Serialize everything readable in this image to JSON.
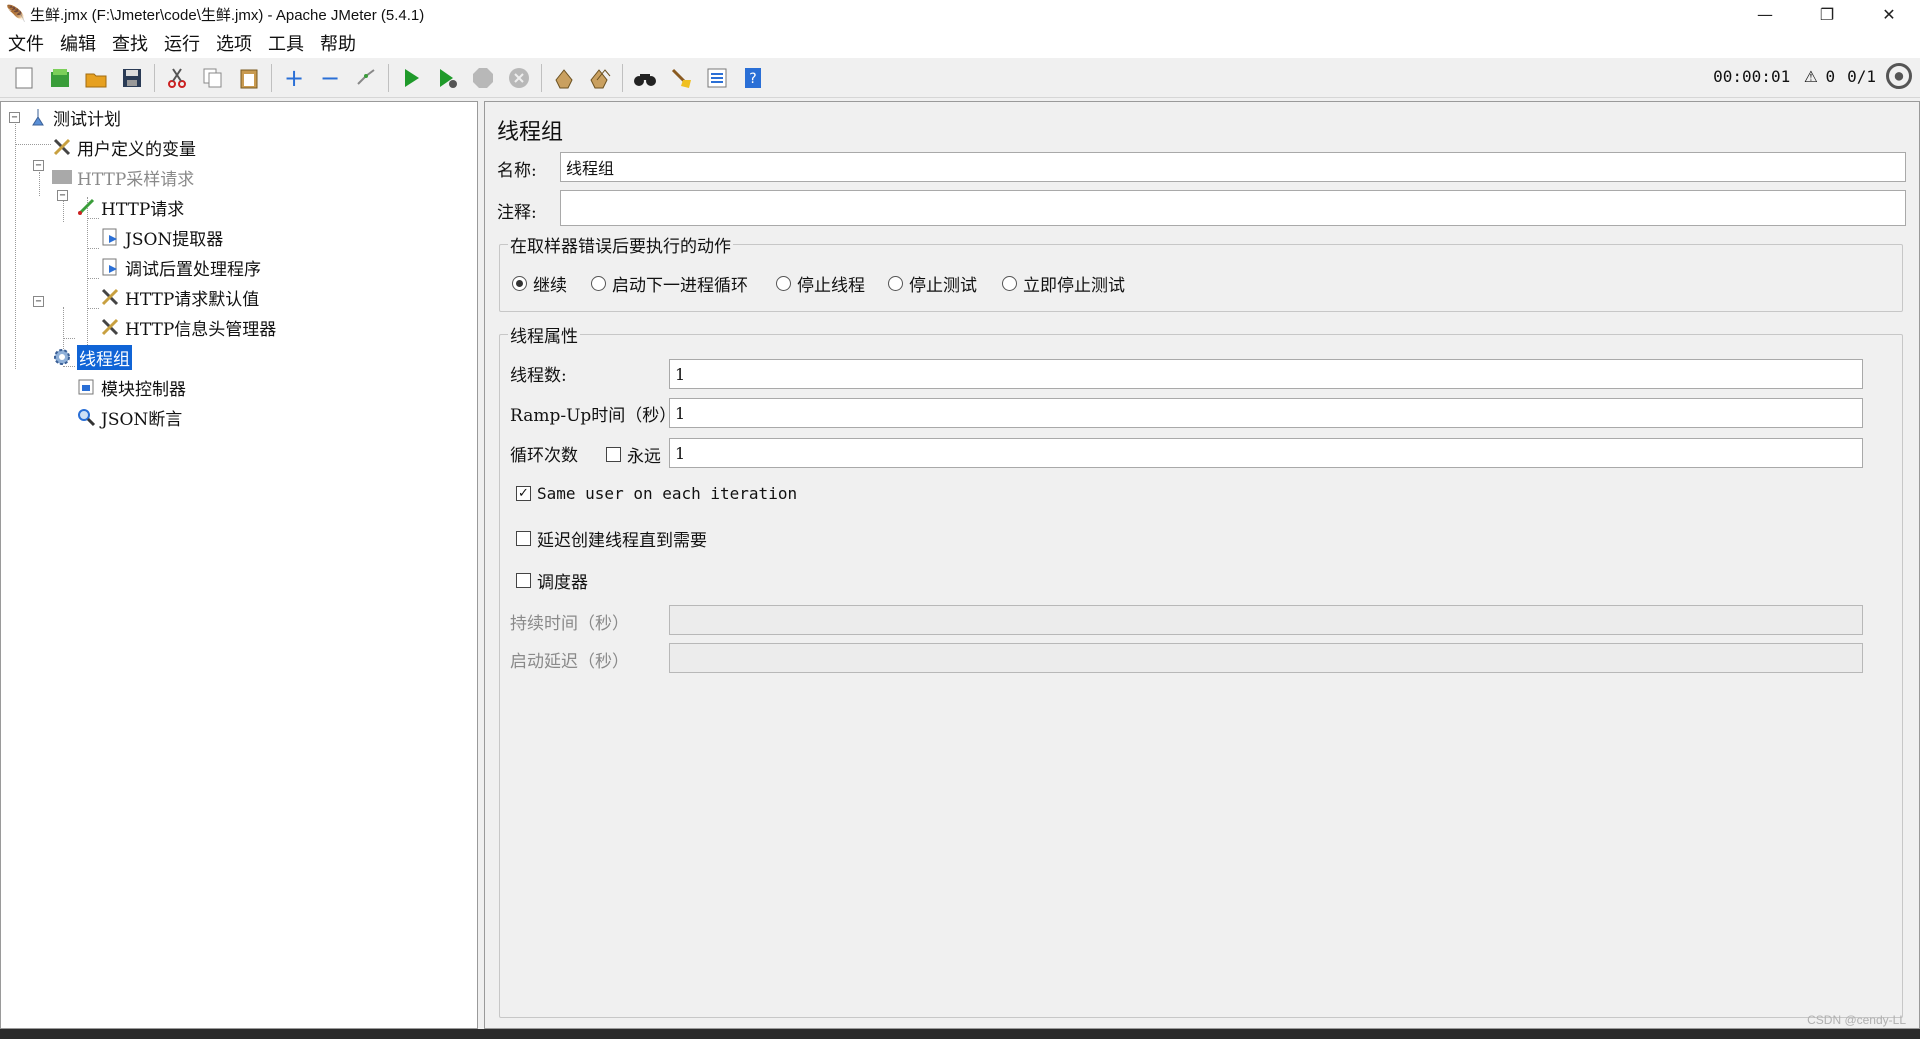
{
  "window": {
    "title": "生鲜.jmx (F:\\Jmeter\\code\\生鲜.jmx) - Apache JMeter (5.4.1)",
    "minimize": "—",
    "restore": "❐",
    "close": "✕"
  },
  "menu": [
    "文件",
    "编辑",
    "查找",
    "运行",
    "选项",
    "工具",
    "帮助"
  ],
  "toolbar": {
    "timer": "00:00:01",
    "warning_count": "0",
    "threads": "0/1",
    "icons": [
      "new-icon",
      "templates-icon",
      "open-icon",
      "save-icon",
      "cut-icon",
      "copy-icon",
      "paste-icon",
      "expand-icon",
      "collapse-icon",
      "toggle-icon",
      "start-icon",
      "start-no-pause-icon",
      "stop-icon",
      "shutdown-icon",
      "clear-icon",
      "clear-all-icon",
      "search-icon",
      "reset-search-icon",
      "function-helper-icon",
      "help-icon"
    ]
  },
  "tree": {
    "nodes": [
      {
        "label": "测试计划",
        "icon": "test-plan-icon"
      },
      {
        "label": "用户定义的变量",
        "icon": "config-tools-icon"
      },
      {
        "label": "HTTP采样请求",
        "icon": "disabled-controller-icon"
      },
      {
        "label": "HTTP请求",
        "icon": "sampler-pen-icon"
      },
      {
        "label": "JSON提取器",
        "icon": "post-processor-icon"
      },
      {
        "label": "调试后置处理程序",
        "icon": "post-processor-icon"
      },
      {
        "label": "HTTP请求默认值",
        "icon": "config-tools-icon"
      },
      {
        "label": "HTTP信息头管理器",
        "icon": "config-tools-icon"
      },
      {
        "label": "线程组",
        "icon": "thread-group-gear-icon"
      },
      {
        "label": "模块控制器",
        "icon": "module-controller-icon"
      },
      {
        "label": "JSON断言",
        "icon": "assertion-magnifier-icon"
      }
    ]
  },
  "editor": {
    "title": "线程组",
    "name_label": "名称:",
    "name_value": "线程组",
    "comment_label": "注释:",
    "comment_value": "",
    "error_group_title": "在取样器错误后要执行的动作",
    "error_actions": [
      {
        "label": "继续",
        "selected": true
      },
      {
        "label": "启动下一进程循环",
        "selected": false
      },
      {
        "label": "停止线程",
        "selected": false
      },
      {
        "label": "停止测试",
        "selected": false
      },
      {
        "label": "立即停止测试",
        "selected": false
      }
    ],
    "props_group_title": "线程属性",
    "threads_label": "线程数:",
    "threads_value": "1",
    "rampup_label": "Ramp-Up时间（秒）:",
    "rampup_value": "1",
    "loop_label": "循环次数",
    "forever_label": "永远",
    "forever_checked": false,
    "loop_value": "1",
    "same_user_label": "Same user on each iteration",
    "same_user_checked": true,
    "delay_label": "延迟创建线程直到需要",
    "delay_checked": false,
    "scheduler_label": "调度器",
    "scheduler_checked": false,
    "duration_label": "持续时间（秒）",
    "duration_value": "",
    "startup_delay_label": "启动延迟（秒）",
    "startup_delay_value": ""
  },
  "watermark": "CSDN @cendy-LL"
}
